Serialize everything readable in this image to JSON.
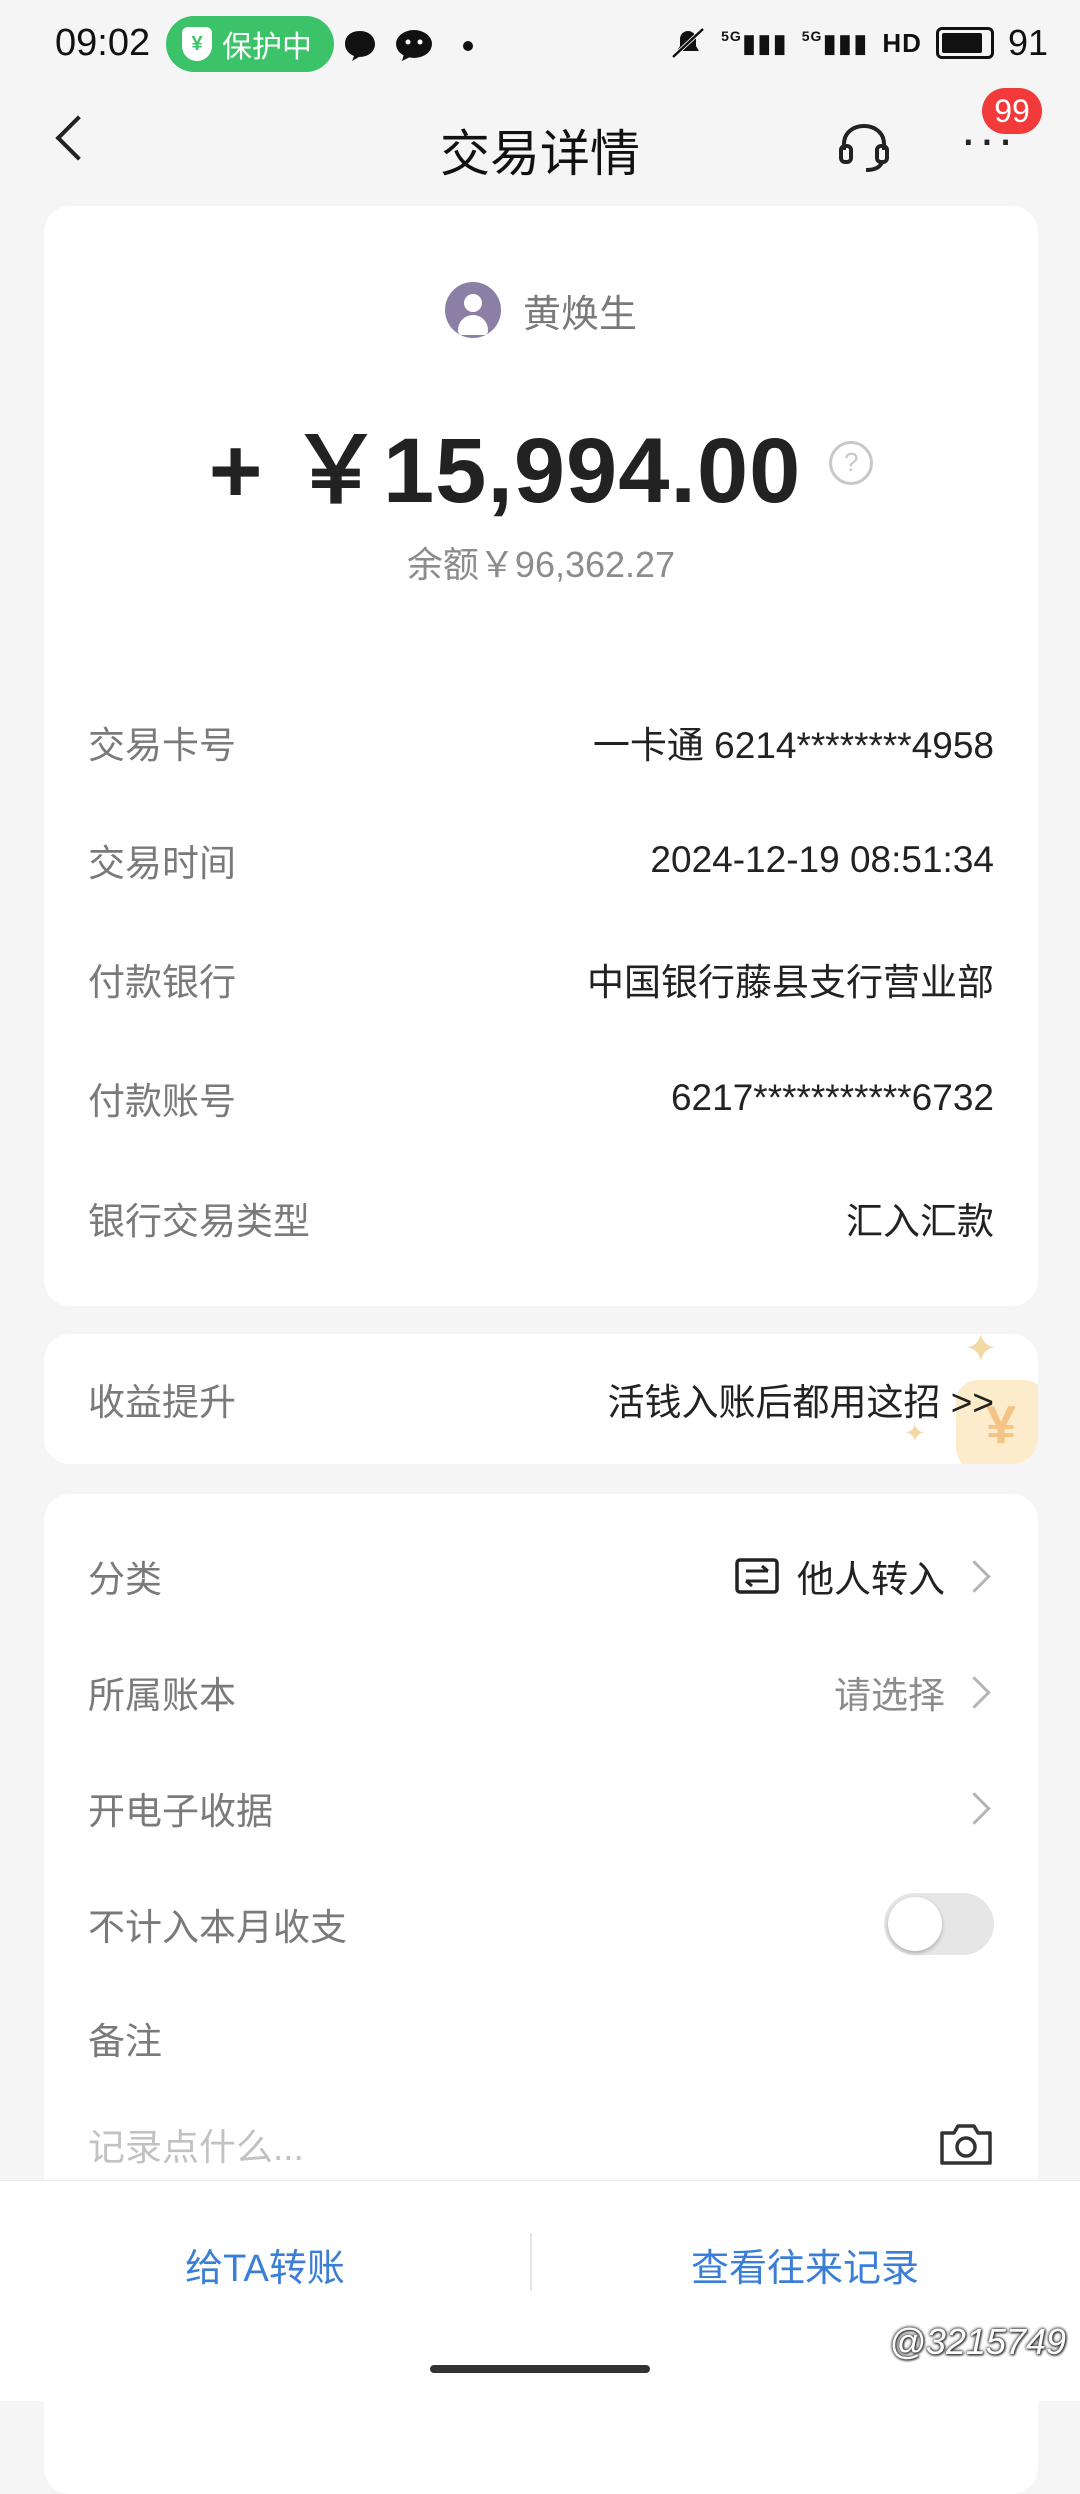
{
  "status_bar": {
    "time": "09:02",
    "protect_label": "保护中",
    "network_1": "5G",
    "network_2": "5G",
    "hd_label": "HD",
    "battery": "91"
  },
  "header": {
    "title": "交易详情",
    "badge_count": "99"
  },
  "transaction": {
    "payer_name": "黄焕生",
    "amount": "+ ￥15,994.00",
    "balance": "余额￥96,362.27",
    "details": [
      {
        "label": "交易卡号",
        "value": "一卡通 6214********4958"
      },
      {
        "label": "交易时间",
        "value": "2024-12-19 08:51:34"
      },
      {
        "label": "付款银行",
        "value": "中国银行藤县支行营业部"
      },
      {
        "label": "付款账号",
        "value": "6217***********6732"
      },
      {
        "label": "银行交易类型",
        "value": "汇入汇款"
      }
    ]
  },
  "promo": {
    "label": "收益提升",
    "value": "活钱入账后都用这招 >>"
  },
  "options": {
    "category_label": "分类",
    "category_value": "他人转入",
    "ledger_label": "所属账本",
    "ledger_value": "请选择",
    "receipt_label": "开电子收据",
    "exclude_label": "不计入本月收支",
    "exclude_on": false,
    "note_label": "备注",
    "note_placeholder": "记录点什么..."
  },
  "bottom": {
    "transfer_label": "给TA转账",
    "history_label": "查看往来记录",
    "watermark": "@3215749"
  },
  "colors": {
    "accent": "#3b7ed6",
    "shield": "#3cc268",
    "badge": "#f23a3a"
  }
}
